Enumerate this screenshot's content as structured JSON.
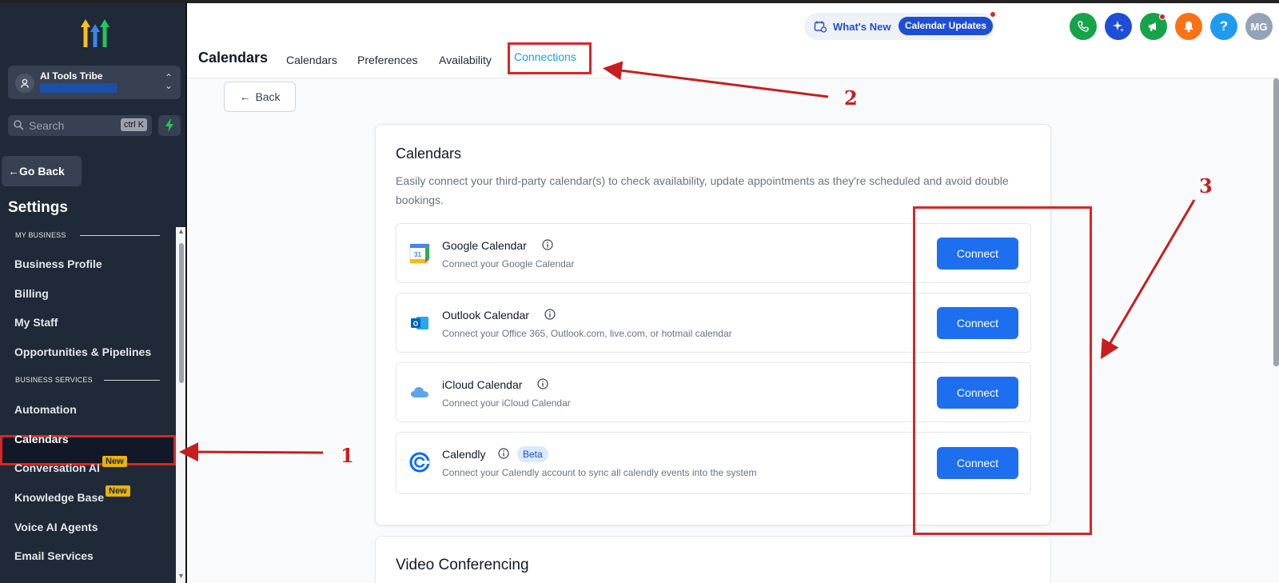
{
  "sidebar": {
    "account_name": "AI Tools Tribe",
    "search_placeholder": "Search",
    "search_shortcut": "ctrl K",
    "go_back": "Go Back",
    "title": "Settings",
    "section_my_business": "MY BUSINESS",
    "section_business_services": "BUSINESS SERVICES",
    "items": [
      {
        "label": "Business Profile"
      },
      {
        "label": "Billing"
      },
      {
        "label": "My Staff"
      },
      {
        "label": "Opportunities & Pipelines"
      },
      {
        "label": "Automation"
      },
      {
        "label": "Calendars"
      },
      {
        "label": "Conversation AI",
        "badge": "New"
      },
      {
        "label": "Knowledge Base",
        "badge": "New"
      },
      {
        "label": "Voice AI Agents"
      },
      {
        "label": "Email Services"
      }
    ],
    "active_item": "Calendars"
  },
  "header": {
    "whats_new": "What's New",
    "calendar_updates": "Calendar Updates",
    "avatar_initials": "MG",
    "help_symbol": "?",
    "page_title": "Calendars",
    "tabs": [
      {
        "label": "Calendars"
      },
      {
        "label": "Preferences"
      },
      {
        "label": "Availability"
      },
      {
        "label": "Connections"
      }
    ],
    "active_tab": "Connections"
  },
  "main": {
    "back_label": "Back",
    "calendars_card": {
      "title": "Calendars",
      "description": "Easily connect your third-party calendar(s) to check availability, update appointments as they're scheduled and avoid double bookings.",
      "items": [
        {
          "title": "Google Calendar",
          "subtitle": "Connect your Google Calendar",
          "button": "Connect",
          "icon": "google-calendar-icon"
        },
        {
          "title": "Outlook Calendar",
          "subtitle": "Connect your Office 365, Outlook.com, live.com, or hotmail calendar",
          "button": "Connect",
          "icon": "outlook-icon"
        },
        {
          "title": "iCloud Calendar",
          "subtitle": "Connect your iCloud Calendar",
          "button": "Connect",
          "icon": "icloud-icon"
        },
        {
          "title": "Calendly",
          "subtitle": "Connect your Calendly account to sync all calendly events into the system",
          "button": "Connect",
          "badge": "Beta",
          "icon": "calendly-icon"
        }
      ]
    },
    "video_card": {
      "title": "Video Conferencing"
    }
  },
  "annotations": {
    "step1": "1",
    "step2": "2",
    "step3": "3"
  },
  "colors": {
    "primary": "#1d6ff0",
    "annotation_red": "#d92626",
    "sidebar_bg": "#1f2937",
    "active_tab": "#0ea5e9"
  }
}
